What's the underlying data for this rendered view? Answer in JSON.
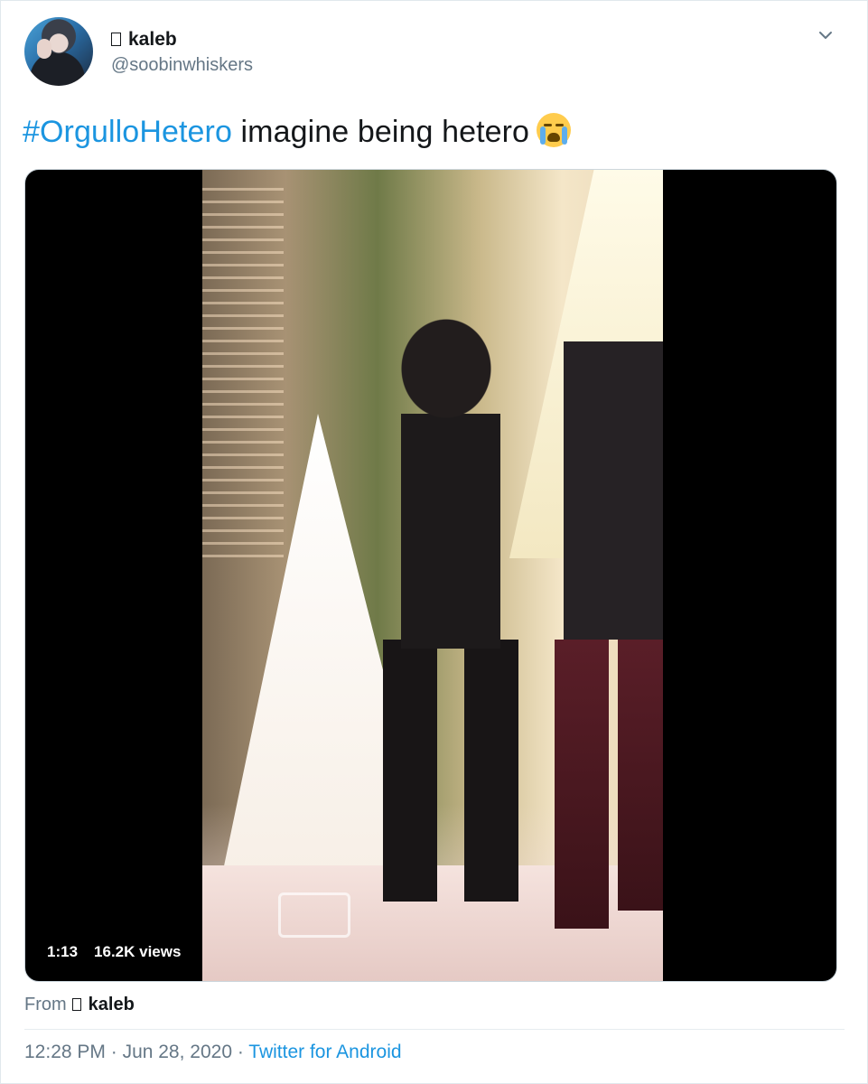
{
  "user": {
    "display_name": "kaleb",
    "handle": "@soobinwhiskers"
  },
  "tweet": {
    "hashtag": "#OrgulloHetero",
    "text": " imagine being hetero",
    "emoji": "loudly-crying-face-emoji"
  },
  "video": {
    "duration": "1:13",
    "views": "16.2K views"
  },
  "from": {
    "prefix": "From",
    "name": "kaleb"
  },
  "meta": {
    "time": "12:28 PM",
    "separator": " · ",
    "date": "Jun 28, 2020",
    "source": "Twitter for Android"
  },
  "colors": {
    "link": "#1b95e0",
    "text": "#14171a",
    "secondary": "#657786"
  }
}
